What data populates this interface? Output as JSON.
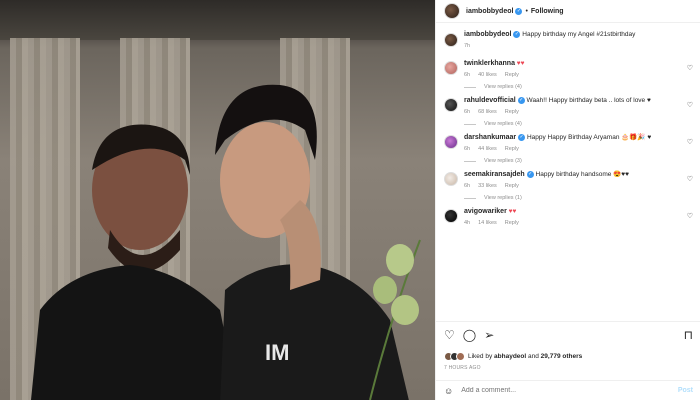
{
  "post": {
    "author": "iambobbydeol",
    "follow_state": "Following",
    "caption_text": "Happy birthday my Angel #21stbirthday",
    "caption_time": "7h"
  },
  "comments": [
    {
      "user": "twinklerkhanna",
      "text": "♥♥",
      "time": "6h",
      "likes": "40 likes",
      "reply": "Reply",
      "view_replies": "View replies (4)"
    },
    {
      "user": "rahuldevofficial",
      "text": "Waah!! Happy birthday beta .. lots of love ♥",
      "time": "6h",
      "likes": "68 likes",
      "reply": "Reply",
      "view_replies": "View replies (4)"
    },
    {
      "user": "darshankumaar",
      "text": "Happy Happy Birthday Aryaman 🎂🎁🎉 ♥",
      "time": "6h",
      "likes": "44 likes",
      "reply": "Reply",
      "view_replies": "View replies (3)"
    },
    {
      "user": "seemakiransajdeh",
      "text": "Happy birthday handsome 😍♥♥",
      "time": "6h",
      "likes": "33 likes",
      "reply": "Reply",
      "view_replies": "View replies (1)"
    },
    {
      "user": "avigowariker",
      "text": "♥♥",
      "time": "4h",
      "likes": "14 likes",
      "reply": "Reply"
    }
  ],
  "likes_summary": {
    "prefix": "Liked by",
    "user": "abhaydeol",
    "and": "and",
    "count": "29,779 others"
  },
  "post_time": "7 HOURS AGO",
  "comment_box": {
    "placeholder": "Add a comment...",
    "post_label": "Post"
  },
  "colors": {
    "accent": "#3897f0",
    "heart": "#ed4956"
  }
}
